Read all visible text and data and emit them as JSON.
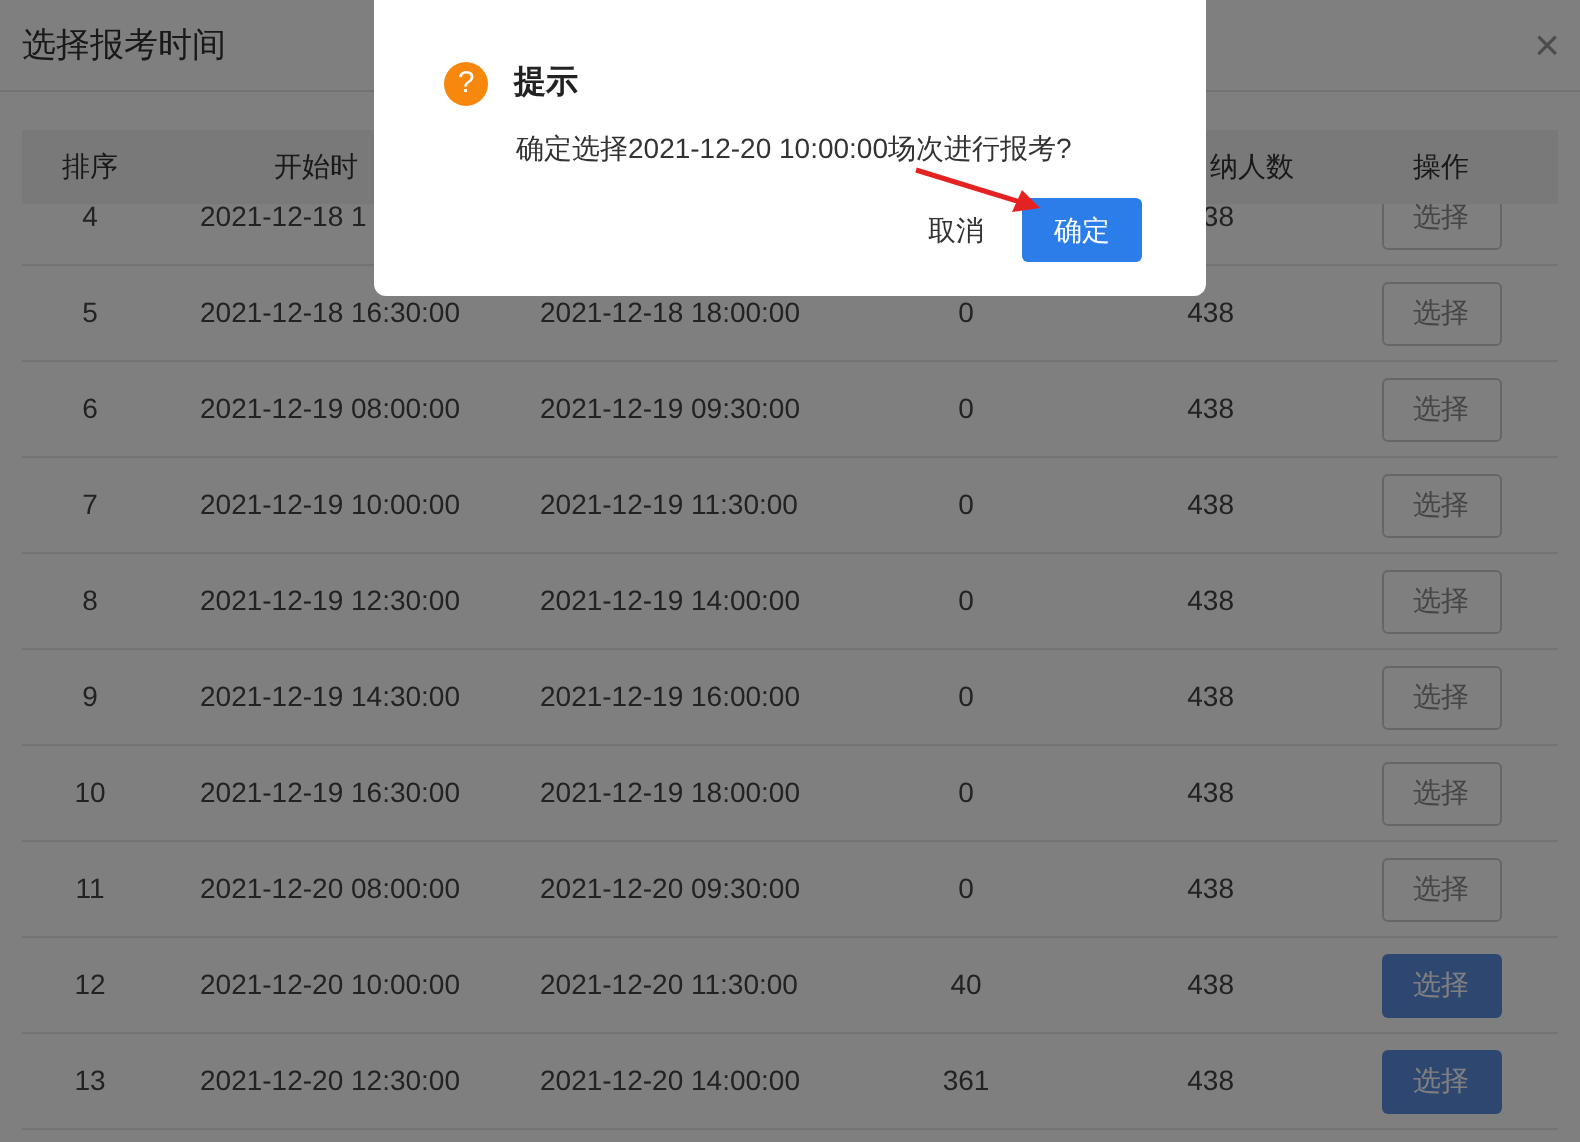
{
  "dialog": {
    "title": "选择报考时间",
    "close": "×"
  },
  "table": {
    "columns": [
      "排序",
      "开始时",
      null,
      null,
      "纳人数",
      "操作"
    ],
    "rows": [
      {
        "order": "4",
        "start": "2021-12-18 1",
        "quota": "38",
        "action": "选择",
        "disabled": true
      },
      {
        "order": "5",
        "start": "2021-12-18 16:30:00",
        "end": "2021-12-18 18:00:00",
        "count": "0",
        "quota": "438",
        "action": "选择",
        "disabled": true
      },
      {
        "order": "6",
        "start": "2021-12-19 08:00:00",
        "end": "2021-12-19 09:30:00",
        "count": "0",
        "quota": "438",
        "action": "选择",
        "disabled": true
      },
      {
        "order": "7",
        "start": "2021-12-19 10:00:00",
        "end": "2021-12-19 11:30:00",
        "count": "0",
        "quota": "438",
        "action": "选择",
        "disabled": true
      },
      {
        "order": "8",
        "start": "2021-12-19 12:30:00",
        "end": "2021-12-19 14:00:00",
        "count": "0",
        "quota": "438",
        "action": "选择",
        "disabled": true
      },
      {
        "order": "9",
        "start": "2021-12-19 14:30:00",
        "end": "2021-12-19 16:00:00",
        "count": "0",
        "quota": "438",
        "action": "选择",
        "disabled": true
      },
      {
        "order": "10",
        "start": "2021-12-19 16:30:00",
        "end": "2021-12-19 18:00:00",
        "count": "0",
        "quota": "438",
        "action": "选择",
        "disabled": true
      },
      {
        "order": "11",
        "start": "2021-12-20 08:00:00",
        "end": "2021-12-20 09:30:00",
        "count": "0",
        "quota": "438",
        "action": "选择",
        "disabled": true
      },
      {
        "order": "12",
        "start": "2021-12-20 10:00:00",
        "end": "2021-12-20 11:30:00",
        "count": "40",
        "quota": "438",
        "action": "选择",
        "disabled": false
      },
      {
        "order": "13",
        "start": "2021-12-20 12:30:00",
        "end": "2021-12-20 14:00:00",
        "count": "361",
        "quota": "438",
        "action": "选择",
        "disabled": false
      }
    ]
  },
  "confirm": {
    "icon": "?",
    "title": "提示",
    "message": "确定选择2021-12-20 10:00:00场次进行报考?",
    "buttons": [
      {
        "label": "取消",
        "kind": "text"
      },
      {
        "label": "确定",
        "kind": "primary"
      }
    ]
  }
}
